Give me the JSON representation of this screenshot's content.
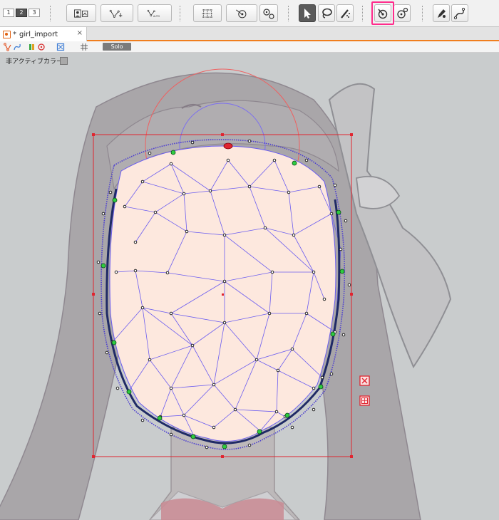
{
  "toolbar": {
    "pages": [
      "1",
      "2",
      "3"
    ],
    "active_page": "2",
    "auto_label": "AUTO"
  },
  "tab": {
    "dirty_mark": "*",
    "title": "girl_import",
    "close": "×"
  },
  "subbar": {
    "solo_label": "Solo"
  },
  "canvas": {
    "inactive_color_label": "非アクティブカラー："
  },
  "colors": {
    "highlight": "#ff2c8c",
    "tab_accent": "#f07e1e",
    "mesh_line": "#6a5cf0",
    "bounding_box": "#e02530",
    "face_fill": "#fde8de",
    "outline": "#1f2a66",
    "control_point": "#2ecc40"
  }
}
